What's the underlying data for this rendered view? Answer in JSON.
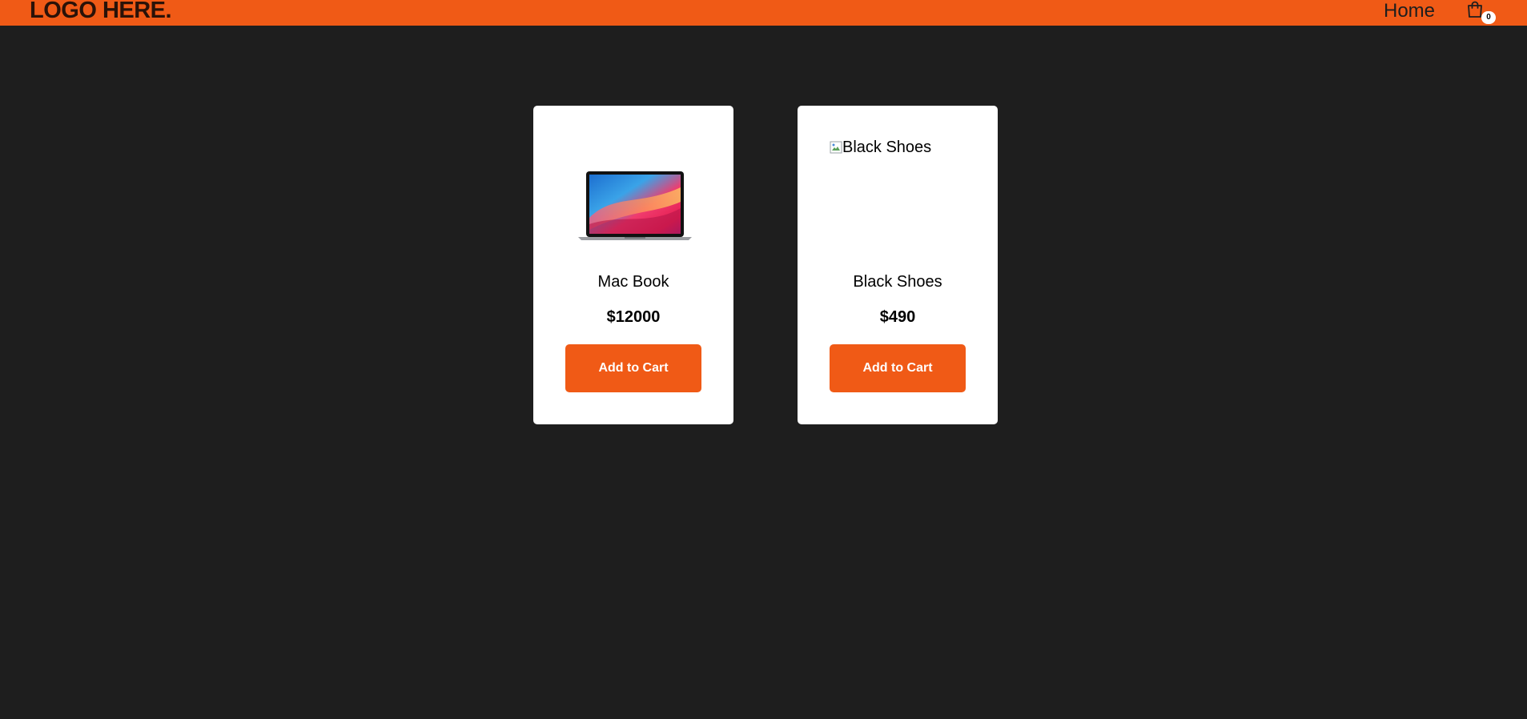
{
  "navbar": {
    "logo": "LOGO HERE.",
    "home_label": "Home",
    "cart_icon": "shopping-bag-icon",
    "cart_count": "0"
  },
  "products": [
    {
      "name": "Mac Book",
      "price": "$12000",
      "button_label": "Add to Cart"
    },
    {
      "name": "Black Shoes",
      "price": "$490",
      "image_alt": "Black Shoes",
      "button_label": "Add to Cart"
    }
  ],
  "colors": {
    "accent": "#f05a16",
    "background": "#1e1e1e",
    "card": "#ffffff"
  }
}
